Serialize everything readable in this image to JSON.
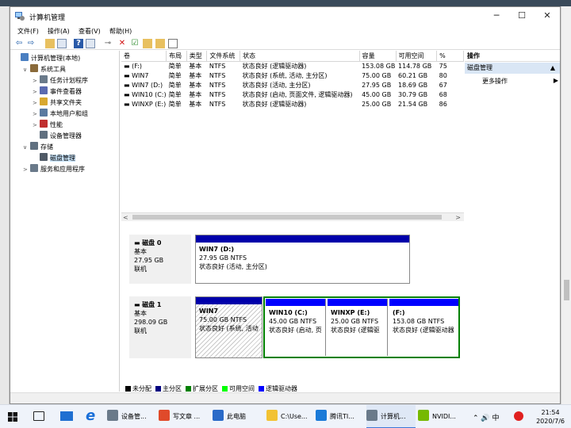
{
  "window": {
    "title": "计算机管理",
    "minimize": "─",
    "maximize": "☐",
    "close": "✕"
  },
  "menu": [
    "文件(F)",
    "操作(A)",
    "查看(V)",
    "帮助(H)"
  ],
  "toolbar_icons": [
    "back-arrow-icon",
    "forward-arrow-icon",
    "folder-icon",
    "show-hide-tree-icon",
    "help-icon",
    "console-icon",
    "connect-icon",
    "delete-icon",
    "checklist-icon",
    "folder-up-icon",
    "folder-search-icon",
    "properties-icon"
  ],
  "tree": [
    {
      "label": "计算机管理(本地)",
      "level": 0,
      "arrow": "",
      "icon": "#4a7fc1"
    },
    {
      "label": "系统工具",
      "level": 1,
      "arrow": "∨",
      "icon": "#8a6a3a"
    },
    {
      "label": "任务计划程序",
      "level": 2,
      "arrow": ">",
      "icon": "#6a7a8a"
    },
    {
      "label": "事件查看器",
      "level": 2,
      "arrow": ">",
      "icon": "#5a6ab0"
    },
    {
      "label": "共享文件夹",
      "level": 2,
      "arrow": ">",
      "icon": "#d8a830"
    },
    {
      "label": "本地用户和组",
      "level": 2,
      "arrow": ">",
      "icon": "#5a7aa0"
    },
    {
      "label": "性能",
      "level": 2,
      "arrow": ">",
      "icon": "#c03030"
    },
    {
      "label": "设备管理器",
      "level": 2,
      "arrow": "",
      "icon": "#607080"
    },
    {
      "label": "存储",
      "level": 1,
      "arrow": "∨",
      "icon": "#607080"
    },
    {
      "label": "磁盘管理",
      "level": 2,
      "arrow": "",
      "icon": "#505a66",
      "selected": true
    },
    {
      "label": "服务和应用程序",
      "level": 1,
      "arrow": ">",
      "icon": "#6a7a8a"
    }
  ],
  "volume_table": {
    "columns": [
      "卷",
      "布局",
      "类型",
      "文件系统",
      "状态",
      "容量",
      "可用空间",
      "%"
    ],
    "rows": [
      [
        "(F:)",
        "简单",
        "基本",
        "NTFS",
        "状态良好 (逻辑驱动器)",
        "153.08 GB",
        "114.78 GB",
        "75"
      ],
      [
        "WIN7",
        "简单",
        "基本",
        "NTFS",
        "状态良好 (系统, 活动, 主分区)",
        "75.00 GB",
        "60.21 GB",
        "80"
      ],
      [
        "WIN7 (D:)",
        "简单",
        "基本",
        "NTFS",
        "状态良好 (活动, 主分区)",
        "27.95 GB",
        "18.69 GB",
        "67"
      ],
      [
        "WIN10 (C:)",
        "简单",
        "基本",
        "NTFS",
        "状态良好 (启动, 页面文件, 逻辑驱动器)",
        "45.00 GB",
        "30.79 GB",
        "68"
      ],
      [
        "WINXP (E:)",
        "简单",
        "基本",
        "NTFS",
        "状态良好 (逻辑驱动器)",
        "25.00 GB",
        "21.54 GB",
        "86"
      ]
    ]
  },
  "scroll": {
    "left": "<",
    "right": ">"
  },
  "disks": [
    {
      "name": "磁盘 0",
      "type": "基本",
      "size": "27.95 GB",
      "status": "联机",
      "partitions": [
        {
          "name": "WIN7  (D:)",
          "size": "27.95 GB NTFS",
          "status": "状态良好 (活动, 主分区)"
        }
      ]
    },
    {
      "name": "磁盘 1",
      "type": "基本",
      "size": "298.09 GB",
      "status": "联机",
      "partitions": [
        {
          "name": "WIN7",
          "size": "75.00 GB NTFS",
          "status": "状态良好 (系统, 活动"
        },
        {
          "name": "WIN10  (C:)",
          "size": "45.00 GB NTFS",
          "status": "状态良好 (启动, 页"
        },
        {
          "name": "WINXP  (E:)",
          "size": "25.00 GB NTFS",
          "status": "状态良好 (逻辑驱"
        },
        {
          "name": "(F:)",
          "size": "153.08 GB NTFS",
          "status": "状态良好 (逻辑驱动器"
        }
      ]
    }
  ],
  "legend": [
    {
      "label": "未分配",
      "color": "#000000"
    },
    {
      "label": "主分区",
      "color": "#000080"
    },
    {
      "label": "扩展分区",
      "color": "#008000"
    },
    {
      "label": "可用空间",
      "color": "#00ff00"
    },
    {
      "label": "逻辑驱动器",
      "color": "#0000ff"
    }
  ],
  "actions": {
    "header": "操作",
    "section": "磁盘管理",
    "section_arrow": "▲",
    "more": "更多操作",
    "more_arrow": "▶"
  },
  "taskbar": {
    "items": [
      {
        "label": "设备管...",
        "icon": "#6a7a8a"
      },
      {
        "label": "写文章 ...",
        "icon": "#e04a2a"
      },
      {
        "label": "此电脑",
        "icon": "#2a6ac8"
      },
      {
        "label": "C:\\Use...",
        "icon": "#f2c232"
      },
      {
        "label": "腾讯TI...",
        "icon": "#1a7ad8"
      },
      {
        "label": "计算机...",
        "icon": "#6a7a8a"
      },
      {
        "label": "NVIDI...",
        "icon": "#76b900"
      }
    ],
    "tray": "⌃ 🔊 中",
    "time": "21:54",
    "date": "2020/7/6"
  }
}
